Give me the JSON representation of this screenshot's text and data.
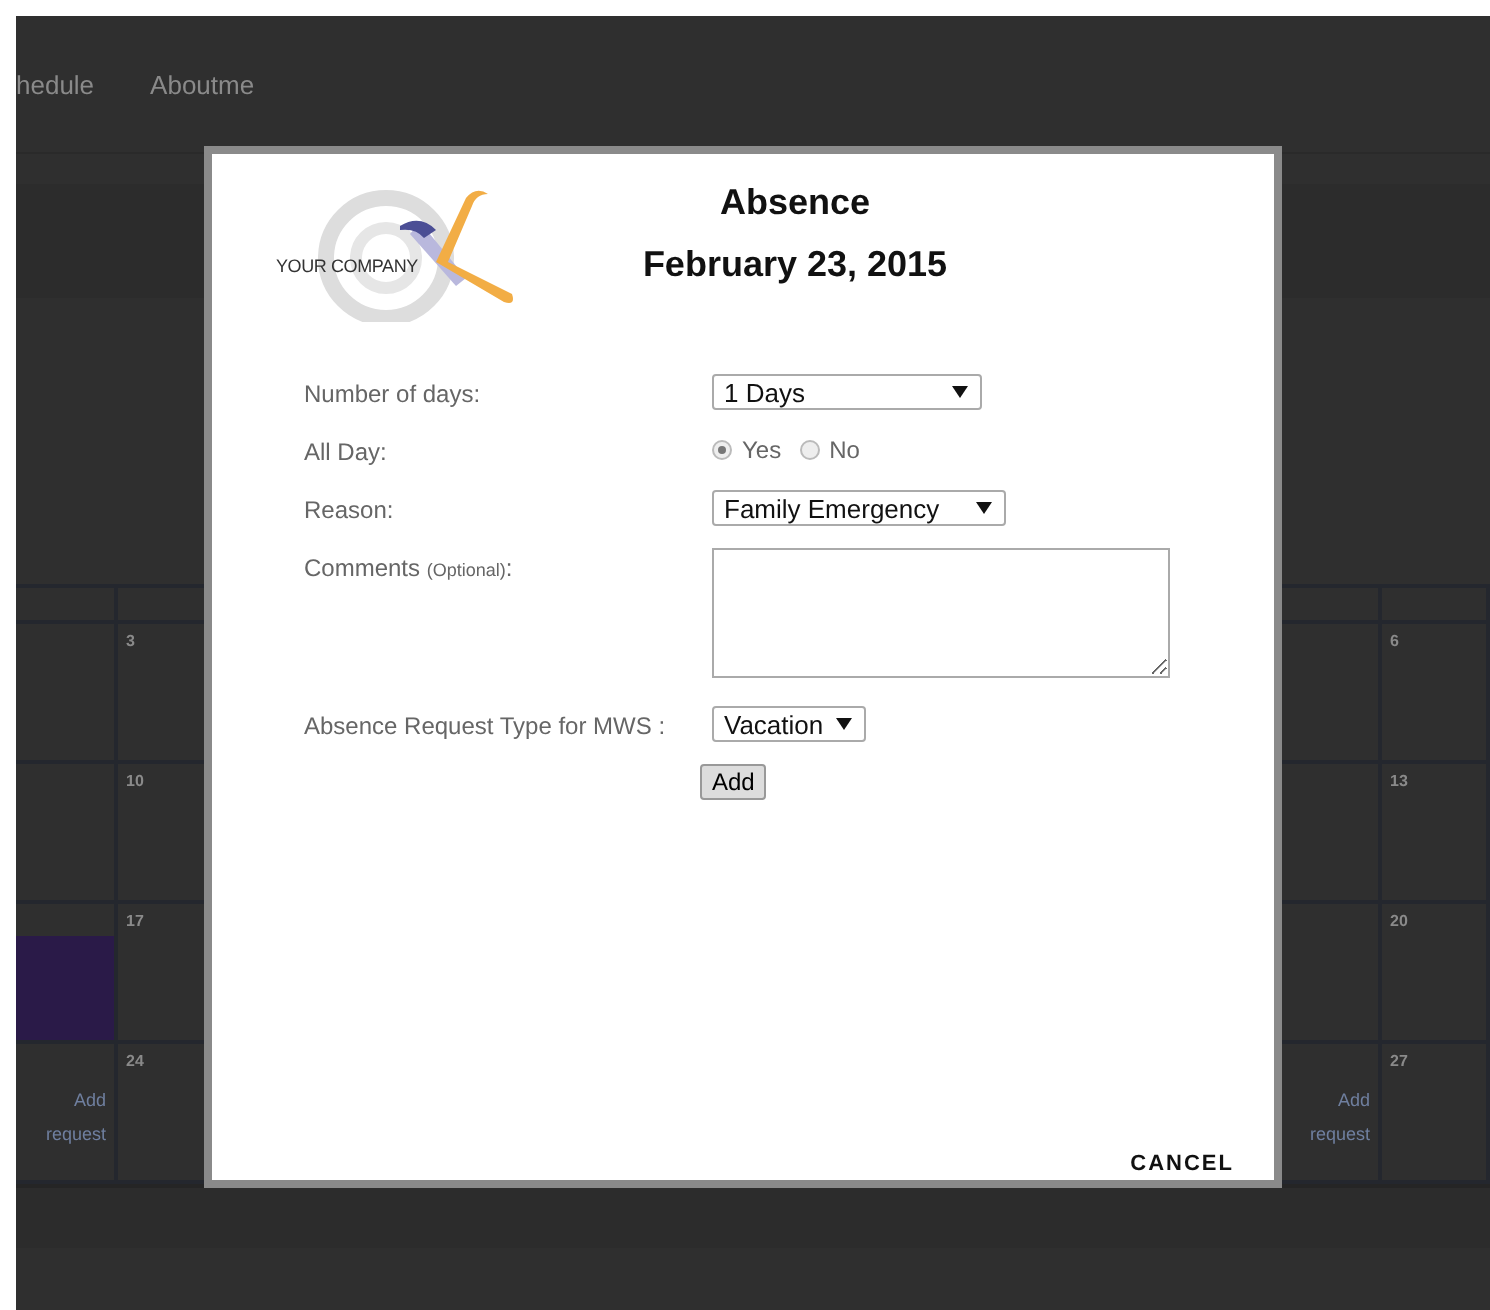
{
  "nav": {
    "items": [
      "hedule",
      "Aboutme"
    ]
  },
  "calendar": {
    "left": [
      {
        "event": false
      },
      {
        "event": false
      },
      {
        "event": true
      },
      {
        "event": false,
        "link": "Add request"
      }
    ],
    "left2": [
      {
        "date": "3"
      },
      {
        "date": "10"
      },
      {
        "date": "17"
      },
      {
        "date": "24"
      }
    ],
    "right_link": "Add request",
    "right2": [
      {
        "date": "6"
      },
      {
        "date": "13"
      },
      {
        "date": "20"
      },
      {
        "date": "27"
      }
    ]
  },
  "dialog": {
    "logo_text": "YOUR COMPANY",
    "title": "Absence",
    "date": "February 23, 2015",
    "fields": [
      {
        "kind": "select",
        "label": "Number of days:",
        "value": "1 Days"
      },
      {
        "kind": "radio",
        "label": "All Day:",
        "options": [
          {
            "label": "Yes",
            "selected": true
          },
          {
            "label": "No",
            "selected": false
          }
        ]
      },
      {
        "kind": "select",
        "label": "Reason:",
        "value": "Family Emergency"
      },
      {
        "kind": "textarea",
        "label": "Comments",
        "note": "(Optional)",
        "suffix": ":"
      },
      {
        "kind": "select",
        "label": "Absence Request Type for MWS :",
        "value": "Vacation"
      }
    ],
    "add_button": "Add",
    "cancel": "CANCEL"
  }
}
